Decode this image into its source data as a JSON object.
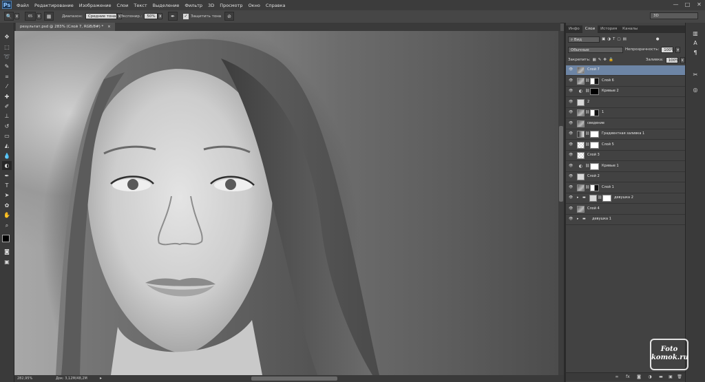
{
  "app": {
    "logo": "Ps"
  },
  "menu": [
    "Файл",
    "Редактирование",
    "Изображение",
    "Слои",
    "Текст",
    "Выделение",
    "Фильтр",
    "3D",
    "Просмотр",
    "Окно",
    "Справка"
  ],
  "window_controls": [
    "—",
    "□",
    "✕"
  ],
  "options": {
    "brush_size": "65",
    "range_label": "Диапазон:",
    "range_value": "Средние тона",
    "exposure_label": "Экспонир.:",
    "exposure_value": "50%",
    "protect_tones": "Защитить тона",
    "workspace": "3D"
  },
  "document": {
    "tab_title": "результат.psd @ 283% (Слой 7, RGB/8#) *",
    "tab_close": "×",
    "zoom": "282,95%",
    "doc_info": "Док: 3,12M/48,2M"
  },
  "panel": {
    "tabs": [
      "Инфо",
      "Слои",
      "История",
      "Каналы"
    ],
    "active_tab": "Слои",
    "filter_kind": "Вид",
    "blend_mode": "Обычные",
    "opacity_label": "Непрозрачность:",
    "opacity_value": "100%",
    "lock_label": "Закрепить:",
    "fill_label": "Заливка:",
    "fill_value": "100%",
    "layers": [
      {
        "name": "Слой 7",
        "selected": true,
        "kind": "image"
      },
      {
        "name": "Слой 6",
        "selected": false,
        "kind": "image-mask"
      },
      {
        "name": "Кривые 2",
        "selected": false,
        "kind": "adjust-mask-dark"
      },
      {
        "name": "2",
        "selected": false,
        "kind": "plain"
      },
      {
        "name": "1",
        "selected": false,
        "kind": "image-mask"
      },
      {
        "name": "сведение",
        "selected": false,
        "kind": "image"
      },
      {
        "name": "Градиентная заливка 1",
        "selected": false,
        "kind": "gradient-mask"
      },
      {
        "name": "Слой 5",
        "selected": false,
        "kind": "transparent-mask"
      },
      {
        "name": "Слой 3",
        "selected": false,
        "kind": "transparent"
      },
      {
        "name": "Кривые 1",
        "selected": false,
        "kind": "adjust-mask"
      },
      {
        "name": "Слой 2",
        "selected": false,
        "kind": "plain"
      },
      {
        "name": "Слой 1",
        "selected": false,
        "kind": "image-mask"
      },
      {
        "name": "девушка 2",
        "selected": false,
        "kind": "group-mask"
      },
      {
        "name": "Слой 4",
        "selected": false,
        "kind": "image"
      },
      {
        "name": "девушка 1",
        "selected": false,
        "kind": "group"
      }
    ]
  },
  "watermark": {
    "line1": "Foto",
    "line2": "komok.ru"
  }
}
